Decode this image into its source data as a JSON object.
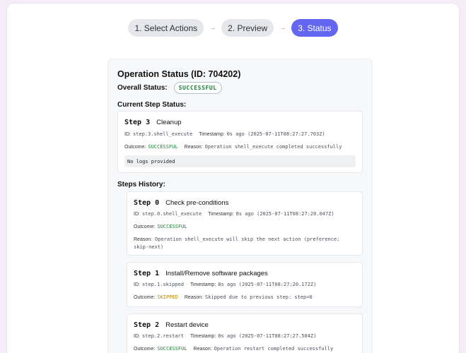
{
  "stepper": {
    "steps": [
      {
        "label": "1. Select Actions",
        "active": false
      },
      {
        "label": "2. Preview",
        "active": false
      },
      {
        "label": "3. Status",
        "active": true
      }
    ],
    "arrow": "→"
  },
  "operation": {
    "title": "Operation Status (ID: 704202)",
    "overall_label": "Overall Status:",
    "overall_value": "SUCCESSFUL",
    "current_label": "Current Step Status:",
    "history_label": "Steps History:"
  },
  "current_step": {
    "num": "Step 3",
    "name": "Cleanup",
    "id_key": "ID:",
    "id": "step.3.shell_execute",
    "ts_key": "Timestamp:",
    "timestamp": "0s ago (2025-07-11T08:27:27.703Z)",
    "outcome_key": "Outcome:",
    "outcome": "SUCCESSFUL",
    "reason_key": "Reason:",
    "reason": "Operation shell_execute completed successfully",
    "logs": "No logs provided"
  },
  "history": [
    {
      "num": "Step 0",
      "name": "Check pre-conditions",
      "id_key": "ID:",
      "id": "step.0.shell_execute",
      "ts_key": "Timestamp:",
      "timestamp": "8s ago (2025-07-11T08:27:20.047Z)",
      "outcome_key": "Outcome:",
      "outcome": "SUCCESSFUL",
      "reason_key": "Reason:",
      "reason": "Operation shell_execute will skip the next action (preference: skip-next)"
    },
    {
      "num": "Step 1",
      "name": "Install/Remove software packages",
      "id_key": "ID:",
      "id": "step.1.skipped",
      "ts_key": "Timestamp:",
      "timestamp": "8s ago (2025-07-11T08:27:20.172Z)",
      "outcome_key": "Outcome:",
      "outcome": "SKIPPED",
      "reason_key": "Reason:",
      "reason": "Skipped due to previous step: step=0"
    },
    {
      "num": "Step 2",
      "name": "Restart device",
      "id_key": "ID:",
      "id": "step.2.restart",
      "ts_key": "Timestamp:",
      "timestamp": "0s ago (2025-07-11T08:27:27.504Z)",
      "outcome_key": "Outcome:",
      "outcome": "SUCCESSFUL",
      "reason_key": "Reason:",
      "reason": "Operation restart completed successfully"
    }
  ],
  "colors": {
    "accent": "#6366f1",
    "success": "#1a7f37",
    "skipped": "#b8860b"
  }
}
